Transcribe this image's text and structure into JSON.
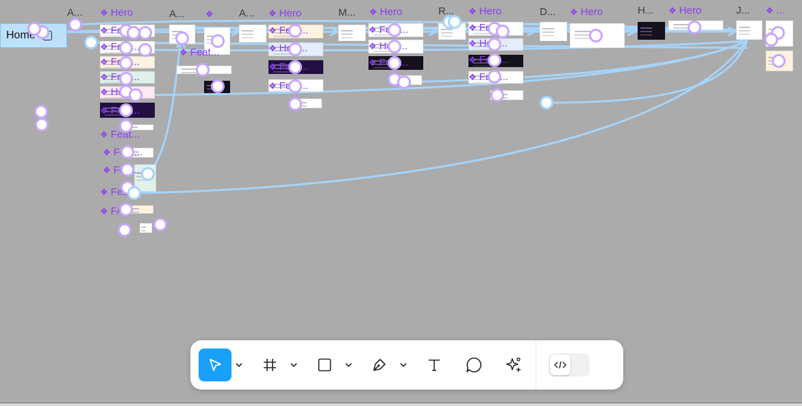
{
  "canvas": {
    "background": "#ababab",
    "connector_color": "#a6d4fa",
    "node_ring_color": "#c8a6ff",
    "component_color": "#8a3cf0",
    "home_tag": {
      "label": "Home",
      "icon": "play-icon"
    },
    "frame_titles": [
      "A...",
      "A...",
      "A...",
      "M...",
      "R...",
      "D...",
      "H...",
      "J..."
    ],
    "component_labels": {
      "hero": "Hero",
      "hero_short": "...",
      "col1": [
        "Feat...",
        "Feat...",
        "Feat...",
        "Feat...",
        "How...",
        "Feat..."
      ],
      "col1_lower": [
        "Feat...",
        "Feat...",
        "Feat...",
        "Feat...",
        "FAQ"
      ],
      "col2": [
        "Feat..."
      ],
      "col3": [
        "Feat...",
        "How...",
        "Feat...",
        "Feat..."
      ],
      "col4": [
        "Feat...",
        "How...",
        "Feat..."
      ],
      "col5": [
        "Feat...",
        "How...",
        "Feat...",
        "Feat..."
      ]
    }
  },
  "toolbar": {
    "tools": [
      {
        "name": "move-tool",
        "icon": "cursor-arrow-icon",
        "active": true,
        "has_dropdown": true
      },
      {
        "name": "frame-tool",
        "icon": "hash-frame-icon",
        "active": false,
        "has_dropdown": true
      },
      {
        "name": "shape-tool",
        "icon": "rectangle-icon",
        "active": false,
        "has_dropdown": true
      },
      {
        "name": "pen-tool",
        "icon": "pen-icon",
        "active": false,
        "has_dropdown": true
      },
      {
        "name": "text-tool",
        "icon": "text-t-icon",
        "active": false,
        "has_dropdown": false
      },
      {
        "name": "comment-tool",
        "icon": "comment-bubble-icon",
        "active": false,
        "has_dropdown": false
      },
      {
        "name": "ai-tool",
        "icon": "sparkle-icon",
        "active": false,
        "has_dropdown": false
      }
    ],
    "dev_mode": {
      "icon": "code-brackets-icon",
      "enabled": false
    },
    "accent": "#18a0fb"
  }
}
